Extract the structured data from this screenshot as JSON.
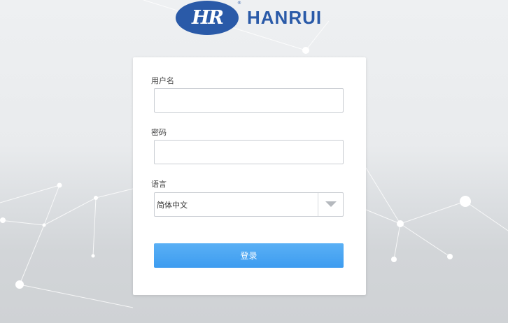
{
  "brand": {
    "logo_monogram": "HR",
    "logo_registered": "®",
    "name": "HANRUI",
    "color": "#2a5aa8"
  },
  "form": {
    "username_label": "用户名",
    "username_value": "",
    "password_label": "密码",
    "password_value": "",
    "language_label": "语言",
    "language_selected": "简体中文",
    "login_button": "登录"
  },
  "colors": {
    "button": "#4aa6f2",
    "button_text": "#ffffff",
    "card": "#ffffff"
  },
  "icons": {
    "dropdown": "chevron-down-icon"
  }
}
